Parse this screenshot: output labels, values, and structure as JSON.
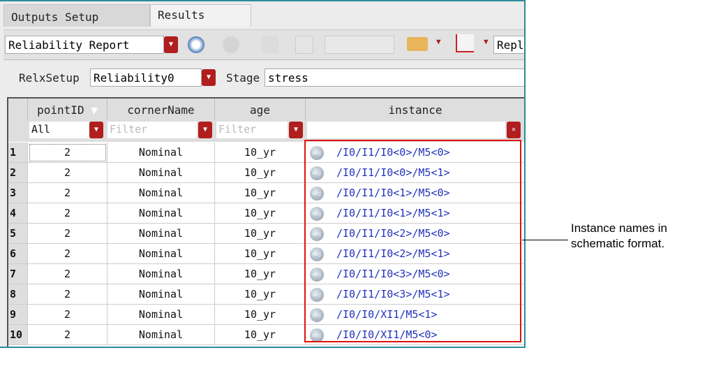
{
  "tabs": [
    "Outputs Setup",
    "Results"
  ],
  "toolbar": {
    "report_select": "Reliability Report",
    "replace_label": "Repl"
  },
  "relx": {
    "setup_label": "RelxSetup",
    "setup_value": "Reliability0",
    "stage_label": "Stage",
    "stage_value": "stress"
  },
  "table": {
    "columns": [
      "pointID",
      "cornerName",
      "age",
      "instance"
    ],
    "filters": {
      "pointID": "All",
      "placeholder": "Filter"
    },
    "rows": [
      {
        "n": "1",
        "pointID": "2",
        "corner": "Nominal",
        "age": "10_yr",
        "instance": "/I0/I1/I0<0>/M5<0>"
      },
      {
        "n": "2",
        "pointID": "2",
        "corner": "Nominal",
        "age": "10_yr",
        "instance": "/I0/I1/I0<0>/M5<1>"
      },
      {
        "n": "3",
        "pointID": "2",
        "corner": "Nominal",
        "age": "10_yr",
        "instance": "/I0/I1/I0<1>/M5<0>"
      },
      {
        "n": "4",
        "pointID": "2",
        "corner": "Nominal",
        "age": "10_yr",
        "instance": "/I0/I1/I0<1>/M5<1>"
      },
      {
        "n": "5",
        "pointID": "2",
        "corner": "Nominal",
        "age": "10_yr",
        "instance": "/I0/I1/I0<2>/M5<0>"
      },
      {
        "n": "6",
        "pointID": "2",
        "corner": "Nominal",
        "age": "10_yr",
        "instance": "/I0/I1/I0<2>/M5<1>"
      },
      {
        "n": "7",
        "pointID": "2",
        "corner": "Nominal",
        "age": "10_yr",
        "instance": "/I0/I1/I0<3>/M5<0>"
      },
      {
        "n": "8",
        "pointID": "2",
        "corner": "Nominal",
        "age": "10_yr",
        "instance": "/I0/I1/I0<3>/M5<1>"
      },
      {
        "n": "9",
        "pointID": "2",
        "corner": "Nominal",
        "age": "10_yr",
        "instance": "/I0/I0/XI1/M5<1>"
      },
      {
        "n": "10",
        "pointID": "2",
        "corner": "Nominal",
        "age": "10_yr",
        "instance": "/I0/I0/XI1/M5<0>"
      }
    ]
  },
  "annotation": {
    "line1": "Instance names in",
    "line2": "schematic format."
  },
  "colors": {
    "accent_red": "#b01e1e",
    "highlight": "#e01010",
    "instance_text": "#2233bb"
  }
}
